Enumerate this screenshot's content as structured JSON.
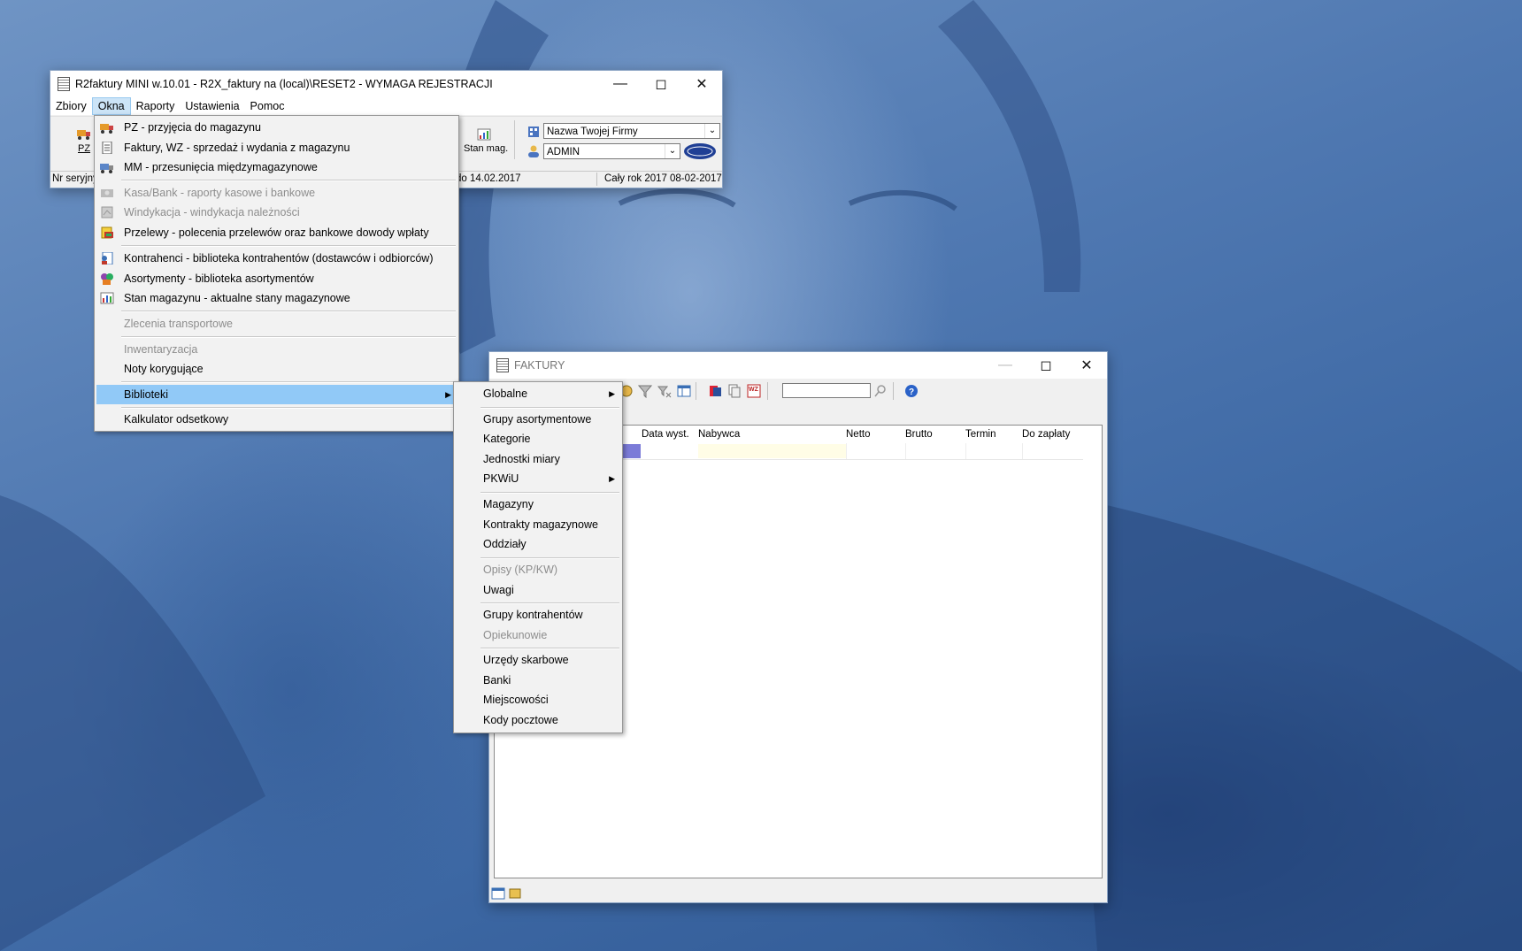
{
  "main_window": {
    "title": "R2faktury MINI w.10.01 - R2X_faktury na (local)\\RESET2 - WYMAGA REJESTRACJI",
    "menu": [
      "Zbiory",
      "Okna",
      "Raporty",
      "Ustawienia",
      "Pomoc"
    ],
    "active_menu": "Okna",
    "toolbar": {
      "pz_label": "PZ",
      "stan_label": "Stan mag."
    },
    "company_combo": "Nazwa Twojej Firmy",
    "user_combo": "ADMIN",
    "status": {
      "serial": "Nr seryjny",
      "date_to": "do 14.02.2017",
      "period": "Cały rok 2017",
      "current_date": "08-02-2017"
    }
  },
  "okna_menu": {
    "items": [
      {
        "label": "PZ - przyjęcia do magazynu",
        "icon": "truck-icon",
        "disabled": false
      },
      {
        "label": "Faktury, WZ - sprzedaż i wydania z magazynu",
        "icon": "invoice-icon",
        "disabled": false
      },
      {
        "label": "MM - przesunięcia międzymagazynowe",
        "icon": "transfer-icon",
        "disabled": false
      },
      {
        "label": "Kasa/Bank - raporty kasowe i bankowe",
        "icon": "cash-icon",
        "disabled": true
      },
      {
        "label": "Windykacja - windykacja należności",
        "icon": "debt-icon",
        "disabled": true
      },
      {
        "label": "Przelewy - polecenia przelewów oraz bankowe dowody wpłaty",
        "icon": "transfer-money-icon",
        "disabled": false
      },
      {
        "label": "Kontrahenci - biblioteka kontrahentów (dostawców i odbiorców)",
        "icon": "contractors-icon",
        "disabled": false
      },
      {
        "label": "Asortymenty - biblioteka asortymentów",
        "icon": "assortment-icon",
        "disabled": false
      },
      {
        "label": "Stan magazynu - aktualne stany magazynowe",
        "icon": "stock-icon",
        "disabled": false
      },
      {
        "label": "Zlecenia transportowe",
        "icon": "",
        "disabled": true
      },
      {
        "label": "Inwentaryzacja",
        "icon": "",
        "disabled": true
      },
      {
        "label": "Noty korygujące",
        "icon": "",
        "disabled": false
      },
      {
        "label": "Biblioteki",
        "icon": "",
        "disabled": false,
        "highlighted": true,
        "submenu": true
      },
      {
        "label": "Kalkulator odsetkowy",
        "icon": "",
        "disabled": false
      }
    ]
  },
  "biblioteki_submenu": {
    "items": [
      {
        "label": "Globalne",
        "disabled": false,
        "submenu": true
      },
      {
        "label": "Grupy asortymentowe",
        "disabled": false
      },
      {
        "label": "Kategorie",
        "disabled": false
      },
      {
        "label": "Jednostki miary",
        "disabled": false
      },
      {
        "label": "PKWiU",
        "disabled": false,
        "submenu": true
      },
      {
        "label": "Magazyny",
        "disabled": false
      },
      {
        "label": "Kontrakty magazynowe",
        "disabled": false
      },
      {
        "label": "Oddziały",
        "disabled": false
      },
      {
        "label": "Opisy (KP/KW)",
        "disabled": true
      },
      {
        "label": "Uwagi",
        "disabled": false
      },
      {
        "label": "Grupy kontrahentów",
        "disabled": false
      },
      {
        "label": "Opiekunowie",
        "disabled": true
      },
      {
        "label": "Urzędy skarbowe",
        "disabled": false
      },
      {
        "label": "Banki",
        "disabled": false
      },
      {
        "label": "Miejscowości",
        "disabled": false
      },
      {
        "label": "Kody pocztowe",
        "disabled": false
      }
    ]
  },
  "faktury_window": {
    "title": "FAKTURY",
    "search_value": "",
    "columns": [
      "Data wyst.",
      "Nabywca",
      "Netto",
      "Brutto",
      "Termin",
      "Do zapłaty"
    ]
  },
  "colors": {
    "menu_highlight": "#91c9f7",
    "disabled_text": "#8d8d8d",
    "active_menu_bg": "#cce4f7",
    "row_selection": "#7b7bd8",
    "nabywca_cell": "#fffde6"
  }
}
